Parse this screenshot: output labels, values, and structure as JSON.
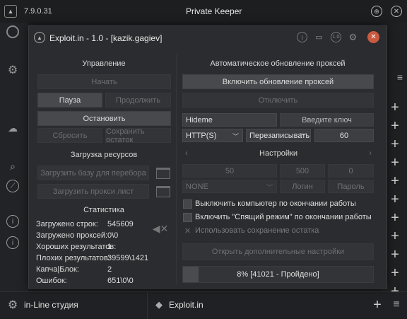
{
  "bg": {
    "version": "7.9.0.31",
    "app_title": "Private Keeper",
    "bottom_left_label": "in-Line студия",
    "bottom_tab_label": "Exploit.in"
  },
  "dialog": {
    "title": "Exploit.in - 1.0 - [kazik.gagiev]",
    "control": {
      "header": "Управление",
      "start": "Начать",
      "pause": "Пауза",
      "continue": "Продолжить",
      "stop": "Остановить",
      "reset": "Сбросить",
      "save_rest": "Сохранить остаток"
    },
    "resources": {
      "header": "Загрузка ресурсов",
      "load_base": "Загрузить базу для перебора",
      "load_proxy": "Загрузить прокси лист"
    },
    "stats": {
      "header": "Статистика",
      "rows": [
        {
          "label": "Загружено строк:",
          "value": "545609"
        },
        {
          "label": "Загружено проксей:",
          "value": "0\\0"
        },
        {
          "label": "Хороших результатов:",
          "value": "1"
        },
        {
          "label": "Плохих результатов:",
          "value": "39599\\1421"
        },
        {
          "label": "Капча|Блок:",
          "value": "2"
        },
        {
          "label": "Ошибок:",
          "value": "651\\0\\0"
        }
      ]
    },
    "proxy": {
      "header": "Автоматическое обновление проксей",
      "enable": "Включить обновление проксей",
      "disable": "Отключить",
      "source": "Hideme",
      "key_placeholder": "Введите ключ",
      "type": "HTTP(S)",
      "mode": "Перезаписывать",
      "interval": "60"
    },
    "settings": {
      "header": "Настройки",
      "threads": "50",
      "timeout": "500",
      "retries": "0",
      "proxy_auth": "NONE",
      "login_placeholder": "Логин",
      "password_placeholder": "Пароль",
      "opt_shutdown": "Выключить компьютер по окончании работы",
      "opt_sleep": "Включить \"Спящий режим\" по окончании работы",
      "opt_save_rest": "Использовать сохранение остатка",
      "more_settings": "Открыть дополнительные настройки"
    },
    "progress": {
      "fraction": 0.08,
      "label": "8% [41021 - Пройдено]"
    }
  }
}
